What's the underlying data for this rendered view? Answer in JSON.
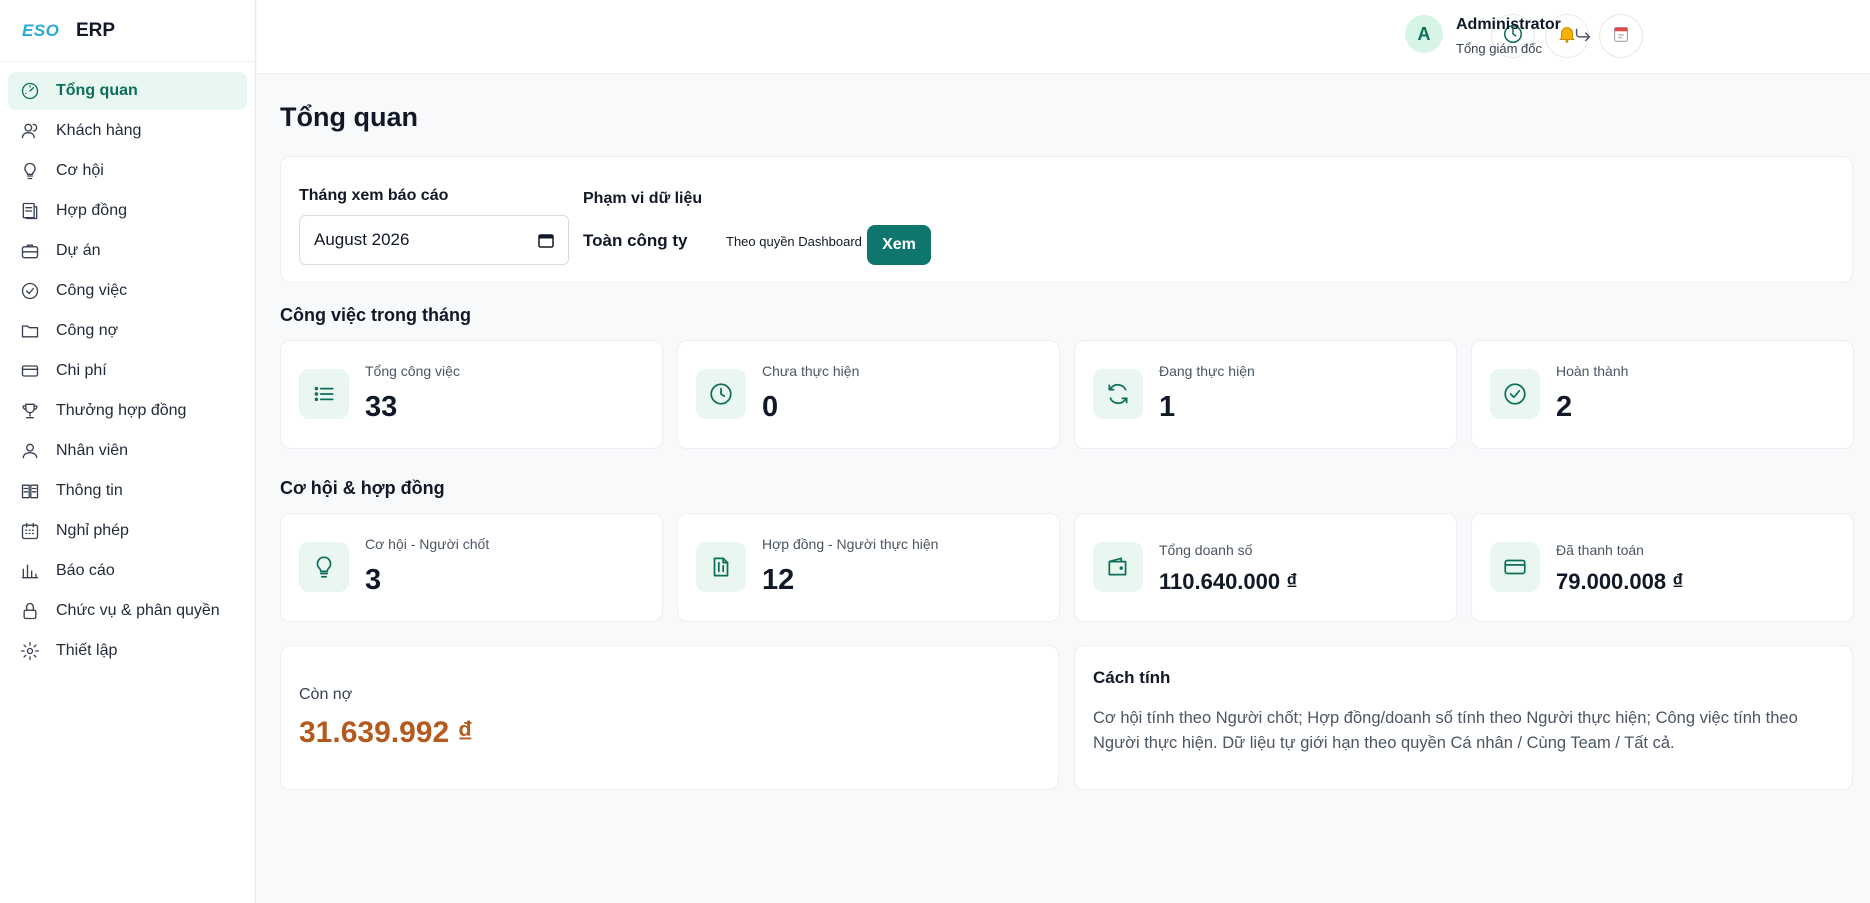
{
  "brand": {
    "logo": "ESO",
    "name": "ERP"
  },
  "sidebar": {
    "items": [
      {
        "label": "Tổng quan",
        "icon": "dashboard-gauge-icon",
        "active": true
      },
      {
        "label": "Khách hàng",
        "icon": "customers-icon"
      },
      {
        "label": "Cơ hội",
        "icon": "lightbulb-icon"
      },
      {
        "label": "Hợp đồng",
        "icon": "contract-icon"
      },
      {
        "label": "Dự án",
        "icon": "briefcase-icon"
      },
      {
        "label": "Công việc",
        "icon": "check-circle-icon"
      },
      {
        "label": "Công nợ",
        "icon": "folder-icon"
      },
      {
        "label": "Chi phí",
        "icon": "credit-card-icon"
      },
      {
        "label": "Thưởng hợp đồng",
        "icon": "trophy-icon"
      },
      {
        "label": "Nhân viên",
        "icon": "user-icon"
      },
      {
        "label": "Thông tin",
        "icon": "newspaper-icon"
      },
      {
        "label": "Nghỉ phép",
        "icon": "calendar-grid-icon"
      },
      {
        "label": "Báo cáo",
        "icon": "bar-chart-icon"
      },
      {
        "label": "Chức vụ & phân quyền",
        "icon": "lock-icon"
      },
      {
        "label": "Thiết lập",
        "icon": "gear-icon"
      }
    ]
  },
  "topbar": {
    "icons": [
      "clock-icon",
      "bell-icon",
      "calendar-icon"
    ],
    "user": {
      "avatar_letter": "A",
      "name": "Administrator",
      "role": "Tổng giám đốc"
    },
    "logout_icon": "logout-icon"
  },
  "page": {
    "title": "Tổng quan"
  },
  "filters": {
    "month_label": "Tháng xem báo cáo",
    "month_value": "August  2026",
    "scope_label": "Phạm vi dữ liệu",
    "scope_value": "Toàn công ty",
    "scope_note": "Theo quyền Dashboard",
    "view_button": "Xem"
  },
  "tasks_section": {
    "title": "Công việc trong tháng",
    "cards": [
      {
        "label": "Tổng công việc",
        "value": "33",
        "icon": "list-icon"
      },
      {
        "label": "Chưa thực hiện",
        "value": "0",
        "icon": "clock-icon"
      },
      {
        "label": "Đang thực hiện",
        "value": "1",
        "icon": "refresh-icon"
      },
      {
        "label": "Hoàn thành",
        "value": "2",
        "icon": "check-circle-icon"
      }
    ]
  },
  "deals_section": {
    "title": "Cơ hội & hợp đồng",
    "cards": [
      {
        "label": "Cơ hội - Người chốt",
        "value": "3",
        "icon": "lightbulb-icon"
      },
      {
        "label": "Hợp đồng - Người thực hiện",
        "value": "12",
        "icon": "documents-icon"
      },
      {
        "label": "Tổng doanh số",
        "value": "110.640.000 ₫",
        "icon": "wallet-icon"
      },
      {
        "label": "Đã thanh toán",
        "value": "79.000.008 ₫",
        "icon": "credit-card-icon"
      }
    ]
  },
  "debt": {
    "label": "Còn nợ",
    "value": "31.639.992 ₫",
    "color": "#b45a1f"
  },
  "calc": {
    "title": "Cách tính",
    "text": "Cơ hội tính theo Người chốt; Hợp đồng/doanh số tính theo Người thực hiện; Công việc tính theo Người thực hiện. Dữ liệu tự giới hạn theo quyền Cá nhân / Cùng Team / Tất cả."
  },
  "colors": {
    "accent": "#0f766e",
    "active_bg": "#e8f7f0",
    "icon_bg": "#eaf7f0"
  }
}
